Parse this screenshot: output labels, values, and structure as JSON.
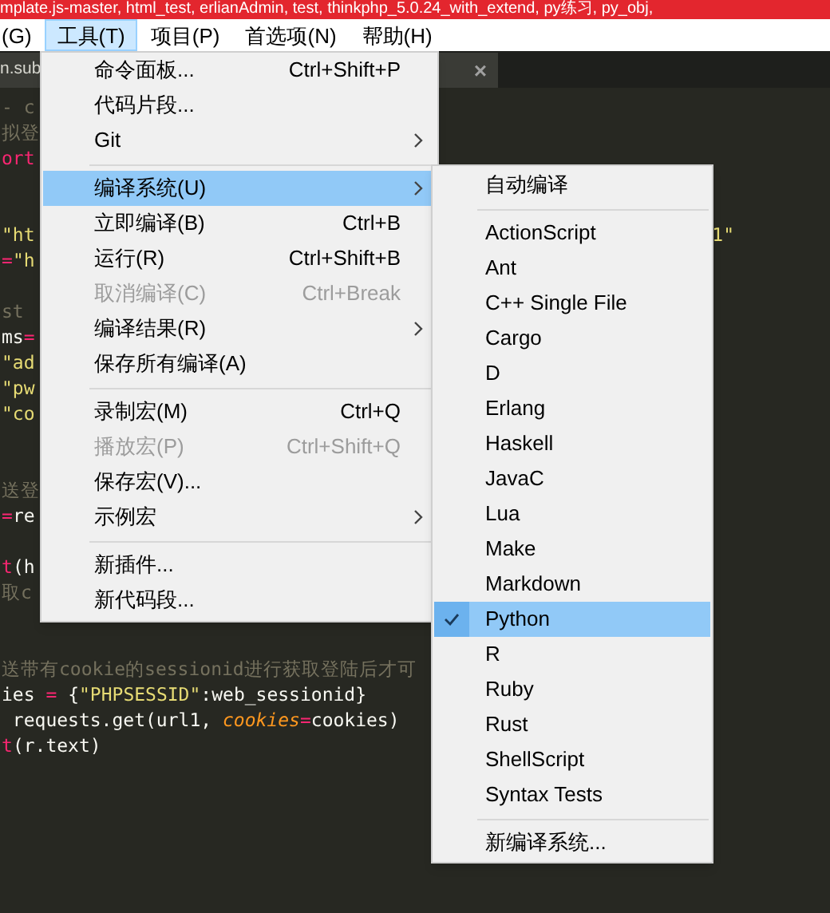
{
  "window": {
    "title": "mplate.js-master, html_test, erlianAdmin, test, thinkphp_5.0.24_with_extend, py练习, py_obj,"
  },
  "menu_bar": [
    {
      "label": "(G)",
      "selected": false
    },
    {
      "label": "工具(T)",
      "selected": true
    },
    {
      "label": "项目(P)",
      "selected": false
    },
    {
      "label": "首选项(N)",
      "selected": false
    },
    {
      "label": "帮助(H)",
      "selected": false
    }
  ],
  "tab": {
    "label": "n.sub",
    "close": "×"
  },
  "editor_lines": [
    {
      "kind": "code",
      "tokens": [
        {
          "kind": "comment",
          "text": "- c"
        }
      ]
    },
    {
      "kind": "code",
      "tokens": [
        {
          "kind": "comment",
          "text": "拟登"
        }
      ]
    },
    {
      "kind": "code",
      "tokens": [
        {
          "kind": "keyword",
          "text": "ort"
        }
      ]
    },
    {
      "kind": "blank"
    },
    {
      "kind": "blank"
    },
    {
      "kind": "code",
      "tokens": [
        {
          "kind": "string",
          "text": "\"ht"
        }
      ],
      "tail": {
        "kind": "string",
        "text": "1\""
      }
    },
    {
      "kind": "code",
      "tokens": [
        {
          "kind": "keyword",
          "text": "="
        },
        {
          "kind": "string",
          "text": "\"h"
        }
      ]
    },
    {
      "kind": "blank"
    },
    {
      "kind": "code",
      "tokens": [
        {
          "kind": "comment",
          "text": "st"
        }
      ]
    },
    {
      "kind": "code",
      "tokens": [
        {
          "kind": "plain",
          "text": "ms"
        },
        {
          "kind": "keyword",
          "text": "="
        }
      ]
    },
    {
      "kind": "code",
      "tokens": [
        {
          "kind": "string",
          "text": "\"ad"
        }
      ]
    },
    {
      "kind": "code",
      "tokens": [
        {
          "kind": "string",
          "text": "\"pw"
        }
      ]
    },
    {
      "kind": "code",
      "tokens": [
        {
          "kind": "string",
          "text": "\"co"
        }
      ]
    },
    {
      "kind": "blank"
    },
    {
      "kind": "blank"
    },
    {
      "kind": "code",
      "tokens": [
        {
          "kind": "comment",
          "text": "送登"
        }
      ]
    },
    {
      "kind": "code",
      "tokens": [
        {
          "kind": "keyword",
          "text": "="
        },
        {
          "kind": "plain",
          "text": "re"
        }
      ]
    },
    {
      "kind": "blank"
    },
    {
      "kind": "code",
      "tokens": [
        {
          "kind": "keyword",
          "text": "t"
        },
        {
          "kind": "plain",
          "text": "(h"
        }
      ]
    },
    {
      "kind": "code",
      "tokens": [
        {
          "kind": "comment",
          "text": "取c"
        }
      ]
    },
    {
      "kind": "blank"
    },
    {
      "kind": "blank"
    },
    {
      "kind": "code",
      "tokens": [
        {
          "kind": "comment",
          "text": "送带有cookie的sessionid进行获取登陆后才可"
        }
      ]
    },
    {
      "kind": "code",
      "tokens": [
        {
          "kind": "plain",
          "text": "ies "
        },
        {
          "kind": "keyword",
          "text": "="
        },
        {
          "kind": "plain",
          "text": " {"
        },
        {
          "kind": "string",
          "text": "\"PHPSESSID\""
        },
        {
          "kind": "plain",
          "text": ":web_sessionid}"
        }
      ]
    },
    {
      "kind": "code",
      "tokens": [
        {
          "kind": "plain",
          "text": " requests.get(url1, "
        },
        {
          "kind": "param",
          "text": "cookies"
        },
        {
          "kind": "keyword",
          "text": "="
        },
        {
          "kind": "plain",
          "text": "cookies)"
        }
      ]
    },
    {
      "kind": "code",
      "tokens": [
        {
          "kind": "keyword",
          "text": "t"
        },
        {
          "kind": "plain",
          "text": "(r.text)"
        }
      ]
    }
  ],
  "tools_menu": [
    {
      "kind": "item",
      "label": "命令面板...",
      "shortcut": "Ctrl+Shift+P",
      "disabled": false,
      "submenu": false,
      "selected": false
    },
    {
      "kind": "item",
      "label": "代码片段...",
      "disabled": false,
      "submenu": false,
      "selected": false
    },
    {
      "kind": "item",
      "label": "Git",
      "disabled": false,
      "submenu": true,
      "selected": false
    },
    {
      "kind": "separator"
    },
    {
      "kind": "item",
      "label": "编译系统(U)",
      "disabled": false,
      "submenu": true,
      "selected": true
    },
    {
      "kind": "item",
      "label": "立即编译(B)",
      "shortcut": "Ctrl+B",
      "disabled": false,
      "submenu": false,
      "selected": false
    },
    {
      "kind": "item",
      "label": "运行(R)",
      "shortcut": "Ctrl+Shift+B",
      "disabled": false,
      "submenu": false,
      "selected": false
    },
    {
      "kind": "item",
      "label": "取消编译(C)",
      "shortcut": "Ctrl+Break",
      "disabled": true,
      "submenu": false,
      "selected": false
    },
    {
      "kind": "item",
      "label": "编译结果(R)",
      "disabled": false,
      "submenu": true,
      "selected": false
    },
    {
      "kind": "item",
      "label": "保存所有编译(A)",
      "disabled": false,
      "submenu": false,
      "selected": false
    },
    {
      "kind": "separator"
    },
    {
      "kind": "item",
      "label": "录制宏(M)",
      "shortcut": "Ctrl+Q",
      "disabled": false,
      "submenu": false,
      "selected": false
    },
    {
      "kind": "item",
      "label": "播放宏(P)",
      "shortcut": "Ctrl+Shift+Q",
      "disabled": true,
      "submenu": false,
      "selected": false
    },
    {
      "kind": "item",
      "label": "保存宏(V)...",
      "disabled": false,
      "submenu": false,
      "selected": false
    },
    {
      "kind": "item",
      "label": "示例宏",
      "disabled": false,
      "submenu": true,
      "selected": false
    },
    {
      "kind": "separator"
    },
    {
      "kind": "item",
      "label": "新插件...",
      "disabled": false,
      "submenu": false,
      "selected": false
    },
    {
      "kind": "item",
      "label": "新代码段...",
      "disabled": false,
      "submenu": false,
      "selected": false
    }
  ],
  "build_system_menu": [
    {
      "kind": "item",
      "label": "自动编译",
      "checked": false,
      "selected": false
    },
    {
      "kind": "separator"
    },
    {
      "kind": "item",
      "label": "ActionScript",
      "checked": false,
      "selected": false
    },
    {
      "kind": "item",
      "label": "Ant",
      "checked": false,
      "selected": false
    },
    {
      "kind": "item",
      "label": "C++ Single File",
      "checked": false,
      "selected": false
    },
    {
      "kind": "item",
      "label": "Cargo",
      "checked": false,
      "selected": false
    },
    {
      "kind": "item",
      "label": "D",
      "checked": false,
      "selected": false
    },
    {
      "kind": "item",
      "label": "Erlang",
      "checked": false,
      "selected": false
    },
    {
      "kind": "item",
      "label": "Haskell",
      "checked": false,
      "selected": false
    },
    {
      "kind": "item",
      "label": "JavaC",
      "checked": false,
      "selected": false
    },
    {
      "kind": "item",
      "label": "Lua",
      "checked": false,
      "selected": false
    },
    {
      "kind": "item",
      "label": "Make",
      "checked": false,
      "selected": false
    },
    {
      "kind": "item",
      "label": "Markdown",
      "checked": false,
      "selected": false
    },
    {
      "kind": "item",
      "label": "Python",
      "checked": true,
      "selected": true
    },
    {
      "kind": "item",
      "label": "R",
      "checked": false,
      "selected": false
    },
    {
      "kind": "item",
      "label": "Ruby",
      "checked": false,
      "selected": false
    },
    {
      "kind": "item",
      "label": "Rust",
      "checked": false,
      "selected": false
    },
    {
      "kind": "item",
      "label": "ShellScript",
      "checked": false,
      "selected": false
    },
    {
      "kind": "item",
      "label": "Syntax Tests",
      "checked": false,
      "selected": false
    },
    {
      "kind": "separator"
    },
    {
      "kind": "item",
      "label": "新编译系统...",
      "checked": false,
      "selected": false
    }
  ]
}
